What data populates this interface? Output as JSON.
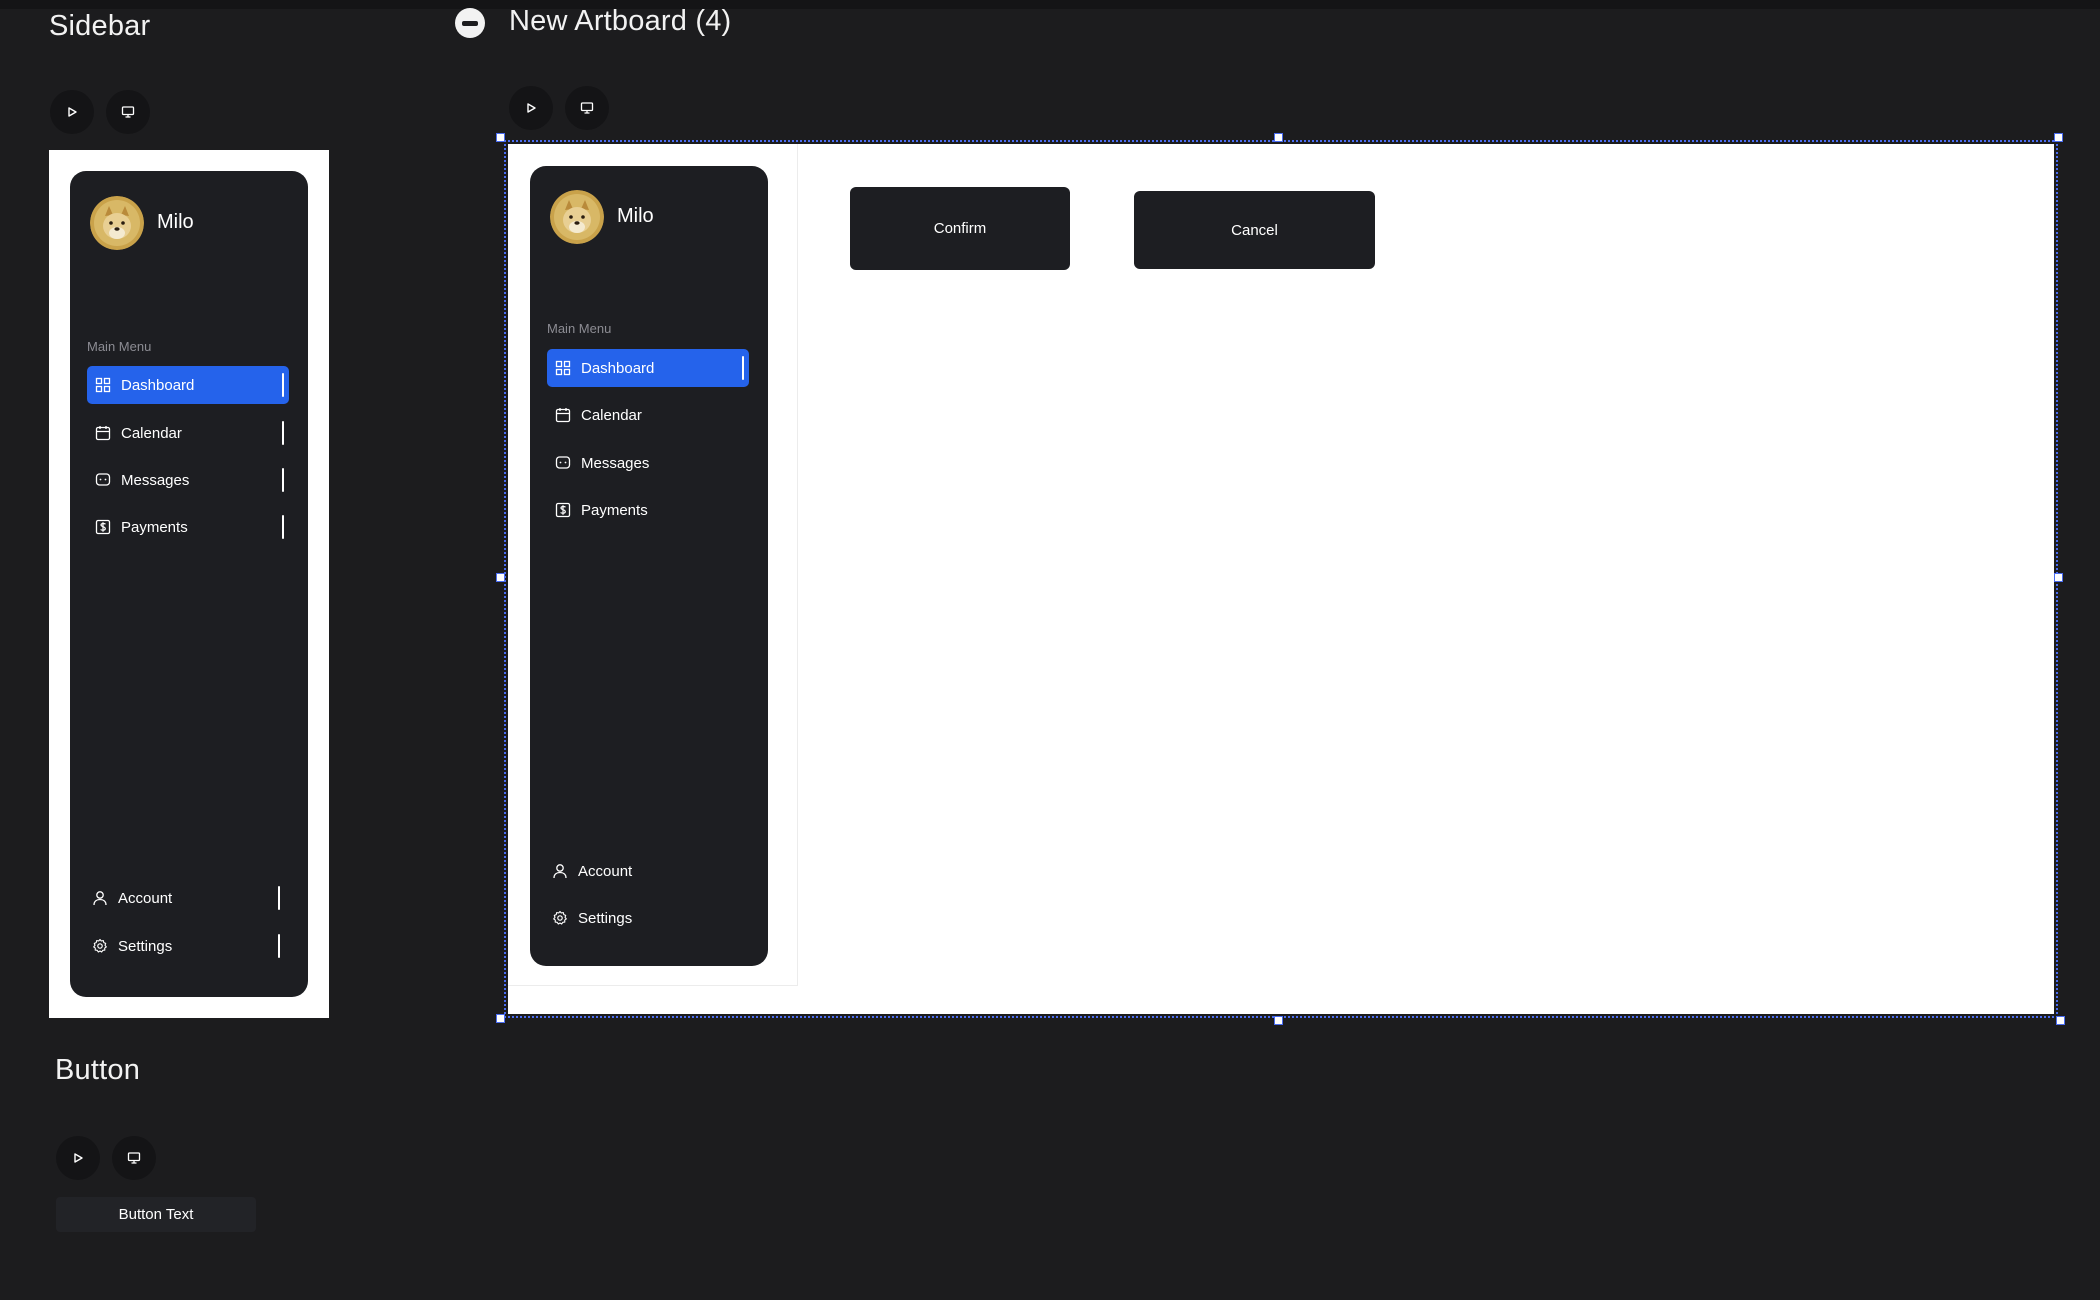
{
  "colors": {
    "canvas": "#1c1c1e",
    "panel": "#1d1e22",
    "accent": "#2563eb",
    "selection": "#4a6cf0",
    "artboard": "#ffffff"
  },
  "sidebar_component": {
    "title": "Sidebar",
    "controls": {
      "play_icon": "play-icon",
      "preview_icon": "monitor-icon"
    },
    "user": {
      "name": "Milo",
      "avatar": "doge-avatar"
    },
    "menu_heading": "Main Menu",
    "items": [
      {
        "label": "Dashboard",
        "icon": "grid-icon",
        "active": true
      },
      {
        "label": "Calendar",
        "icon": "calendar-icon",
        "active": false
      },
      {
        "label": "Messages",
        "icon": "message-icon",
        "active": false
      },
      {
        "label": "Payments",
        "icon": "dollar-icon",
        "active": false
      }
    ],
    "footer_items": [
      {
        "label": "Account",
        "icon": "user-icon"
      },
      {
        "label": "Settings",
        "icon": "gear-icon"
      }
    ]
  },
  "artboard": {
    "title": "New Artboard (4)",
    "collapse_icon": "minus-circle-icon",
    "controls": {
      "play_icon": "play-icon",
      "preview_icon": "monitor-icon"
    },
    "sidebar": {
      "user": {
        "name": "Milo",
        "avatar": "doge-avatar"
      },
      "menu_heading": "Main Menu",
      "items": [
        {
          "label": "Dashboard",
          "icon": "grid-icon",
          "active": true
        },
        {
          "label": "Calendar",
          "icon": "calendar-icon",
          "active": false
        },
        {
          "label": "Messages",
          "icon": "message-icon",
          "active": false
        },
        {
          "label": "Payments",
          "icon": "dollar-icon",
          "active": false
        }
      ],
      "footer_items": [
        {
          "label": "Account",
          "icon": "user-icon"
        },
        {
          "label": "Settings",
          "icon": "gear-icon"
        }
      ]
    },
    "confirm_label": "Confirm",
    "cancel_label": "Cancel"
  },
  "button_component": {
    "title": "Button",
    "controls": {
      "play_icon": "play-icon",
      "preview_icon": "monitor-icon"
    },
    "label": "Button Text"
  }
}
